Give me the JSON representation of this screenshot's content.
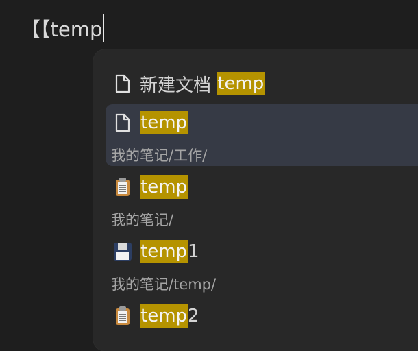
{
  "editor": {
    "line_text": "【【temp"
  },
  "suggestions": {
    "new_doc": {
      "label_prefix": "新建文档 ",
      "label_match": "temp",
      "icon": "file-icon"
    },
    "items": [
      {
        "title_match": "temp",
        "title_rest": "",
        "path": "我的笔记/工作/",
        "icon": "file-icon",
        "selected": true
      },
      {
        "title_match": "temp",
        "title_rest": "",
        "path": "我的笔记/",
        "icon": "clipboard-icon",
        "selected": false
      },
      {
        "title_match": "temp",
        "title_rest": "1",
        "path": "我的笔记/temp/",
        "icon": "floppy-disk-icon",
        "selected": false
      },
      {
        "title_match": "temp",
        "title_rest": "2",
        "path": "",
        "icon": "clipboard-icon",
        "selected": false
      }
    ]
  },
  "colors": {
    "background": "#1e1e1e",
    "popup": "#282828",
    "selected_row": "#363a45",
    "highlight": "#b59300"
  }
}
